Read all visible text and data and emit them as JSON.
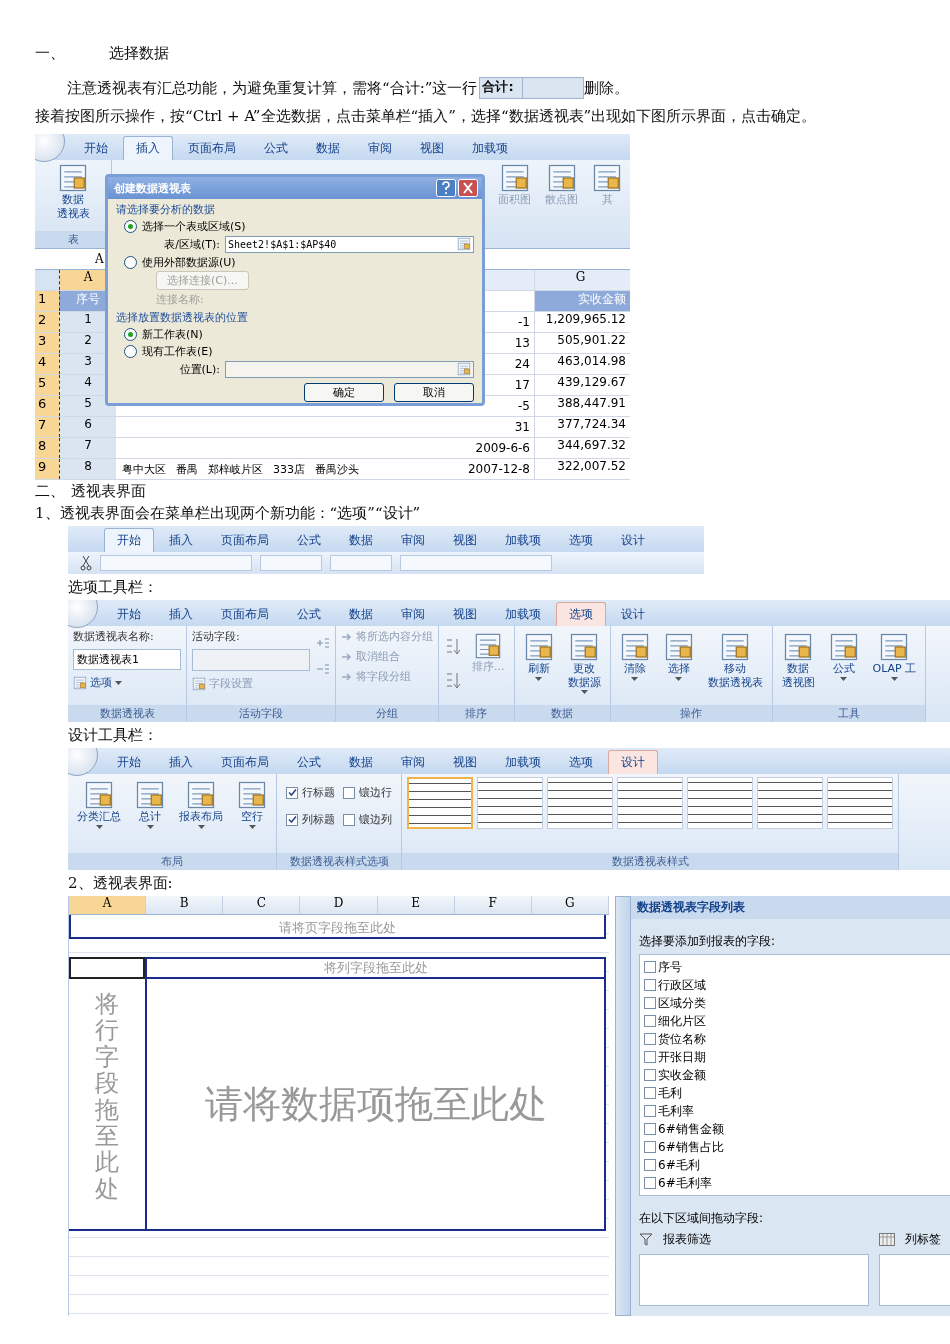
{
  "heading": {
    "number": "一、",
    "text": "选择数据"
  },
  "intro": [
    {
      "before": "注意透视表有汇总功能，为避免重复计算，需将“合计:”这一行",
      "cell": "合计:",
      "after": "删除。"
    },
    {
      "before": "接着按图所示操作，按“Ctrl + A”全选数据，点击菜单栏“插入”，选择“数据透视表”出现如下图所示界面，点击确定。"
    }
  ],
  "excel_insert": {
    "tabs": [
      {
        "label": "开始",
        "selected": false
      },
      {
        "label": "插入",
        "selected": true
      },
      {
        "label": "页面布局",
        "selected": false
      },
      {
        "label": "公式",
        "selected": false
      },
      {
        "label": "数据",
        "selected": false
      },
      {
        "label": "审阅",
        "selected": false
      },
      {
        "label": "视图",
        "selected": false
      },
      {
        "label": "加载项",
        "selected": false
      }
    ],
    "ribbon": {
      "pivot_button": [
        "数据",
        "透视表"
      ],
      "group_label": "表",
      "chart_buttons": [
        "面积图",
        "散点图",
        "其"
      ]
    },
    "name_box": "A",
    "columns": [
      {
        "label": "A",
        "selected": true
      },
      {
        "label": "G",
        "selected": false
      }
    ],
    "rows": [
      {
        "number": "1",
        "a": "序号",
        "g": "实收金额"
      },
      {
        "number": "2",
        "a": "1",
        "f": "-1",
        "g": "1,209,965.12"
      },
      {
        "number": "3",
        "a": "2",
        "f": "13",
        "g": "505,901.22"
      },
      {
        "number": "4",
        "a": "3",
        "f": "24",
        "g": "463,014.98"
      },
      {
        "number": "5",
        "a": "4",
        "f": "17",
        "g": "439,129.67"
      },
      {
        "number": "6",
        "a": "5",
        "f": "-5",
        "g": "388,447.91"
      },
      {
        "number": "7",
        "a": "6",
        "f": "31",
        "g": "377,724.34"
      },
      {
        "number": "8",
        "a": "7",
        "f": "2009-6-6",
        "g": "344,697.32"
      },
      {
        "number": "9",
        "a": "8",
        "middle": [
          "粤中大区",
          "番禺",
          "郑梓岐片区",
          "333店",
          "番禺沙头"
        ],
        "f": "2007-12-8",
        "g": "322,007.52"
      }
    ],
    "dialog": {
      "title": "创建数据透视表",
      "section_1": "请选择要分析的数据",
      "source_options": [
        {
          "label": "选择一个表或区域(S)",
          "selected": true
        },
        {
          "label": "使用外部数据源(U)",
          "selected": false
        }
      ],
      "range_label": "表/区域(T):",
      "range_value": "Sheet2!$A$1:$AP$40",
      "connection_button": "选择连接(C)...",
      "connection_label": "连接名称:",
      "section_2": "选择放置数据透视表的位置",
      "target_options": [
        {
          "label": "新工作表(N)",
          "selected": true
        },
        {
          "label": "现有工作表(E)",
          "selected": false
        }
      ],
      "location_label": "位置(L):",
      "ok": "确定",
      "cancel": "取消"
    }
  },
  "section_two": {
    "number": "二、",
    "text": "透视表界面",
    "note": "1、透视表界面会在菜单栏出现两个新功能：“选项”“设计”"
  },
  "ribbon_strip": {
    "tabs": [
      {
        "label": "开始",
        "selected": true
      },
      {
        "label": "插入",
        "selected": false
      },
      {
        "label": "页面布局",
        "selected": false
      },
      {
        "label": "公式",
        "selected": false
      },
      {
        "label": "数据",
        "selected": false
      },
      {
        "label": "审阅",
        "selected": false
      },
      {
        "label": "视图",
        "selected": false
      },
      {
        "label": "加载项",
        "selected": false
      },
      {
        "label": "选项",
        "selected": false
      },
      {
        "label": "设计",
        "selected": false
      }
    ]
  },
  "options_caption": "选项工具栏：",
  "options_ribbon": {
    "tabs": [
      {
        "label": "开始",
        "selected": false
      },
      {
        "label": "插入",
        "selected": false
      },
      {
        "label": "页面布局",
        "selected": false
      },
      {
        "label": "公式",
        "selected": false
      },
      {
        "label": "数据",
        "selected": false
      },
      {
        "label": "审阅",
        "selected": false
      },
      {
        "label": "视图",
        "selected": false
      },
      {
        "label": "加载项",
        "selected": false
      },
      {
        "label": "选项",
        "selected": true
      },
      {
        "label": "设计",
        "selected": false
      }
    ],
    "groups": [
      {
        "kind": "pivot_name",
        "label": "数据透视表",
        "caption": "数据透视表名称:",
        "value": "数据透视表1",
        "button": "选项"
      },
      {
        "kind": "active_field",
        "label": "活动字段",
        "caption": "活动字段:",
        "button": "字段设置"
      },
      {
        "kind": "list",
        "label": "分组",
        "items": [
          "将所选内容分组",
          "取消组合",
          "将字段分组"
        ]
      },
      {
        "kind": "sort",
        "label": "排序",
        "button": "排序..."
      },
      {
        "kind": "buttons",
        "label": "数据",
        "items": [
          {
            "lines": [
              "刷新"
            ],
            "dropdown": true
          },
          {
            "lines": [
              "更改",
              "数据源"
            ],
            "dropdown": true
          }
        ]
      },
      {
        "kind": "buttons",
        "label": "操作",
        "items": [
          {
            "lines": [
              "清除"
            ],
            "dropdown": true
          },
          {
            "lines": [
              "选择"
            ],
            "dropdown": true
          },
          {
            "lines": [
              "移动",
              "数据透视表"
            ],
            "dropdown": false
          }
        ]
      },
      {
        "kind": "buttons",
        "label": "工具",
        "items": [
          {
            "lines": [
              "数据",
              "透视图"
            ],
            "dropdown": false
          },
          {
            "lines": [
              "公式"
            ],
            "dropdown": true
          },
          {
            "lines": [
              "OLAP 工"
            ],
            "dropdown": true
          }
        ]
      }
    ]
  },
  "design_caption": "设计工具栏：",
  "design_ribbon": {
    "tabs": [
      {
        "label": "开始",
        "selected": false
      },
      {
        "label": "插入",
        "selected": false
      },
      {
        "label": "页面布局",
        "selected": false
      },
      {
        "label": "公式",
        "selected": false
      },
      {
        "label": "数据",
        "selected": false
      },
      {
        "label": "审阅",
        "selected": false
      },
      {
        "label": "视图",
        "selected": false
      },
      {
        "label": "加载项",
        "selected": false
      },
      {
        "label": "选项",
        "selected": false
      },
      {
        "label": "设计",
        "selected": true
      }
    ],
    "groups": [
      {
        "kind": "buttons",
        "label": "布局",
        "items": [
          {
            "lines": [
              "分类汇总"
            ],
            "dropdown": true
          },
          {
            "lines": [
              "总计"
            ],
            "dropdown": true
          },
          {
            "lines": [
              "报表布局"
            ],
            "dropdown": true
          },
          {
            "lines": [
              "空行"
            ],
            "dropdown": true
          }
        ]
      },
      {
        "kind": "checks",
        "label": "数据透视表样式选项",
        "items": [
          {
            "label": "行标题",
            "checked": true
          },
          {
            "label": "镶边行",
            "checked": false
          },
          {
            "label": "列标题",
            "checked": true
          },
          {
            "label": "镶边列",
            "checked": false
          }
        ]
      },
      {
        "kind": "styles",
        "label": "数据透视表样式",
        "items": [
          {
            "selected": true
          },
          {
            "selected": false
          },
          {
            "selected": false
          },
          {
            "selected": false
          },
          {
            "selected": false
          },
          {
            "selected": false
          },
          {
            "selected": false
          }
        ]
      }
    ]
  },
  "pivot_caption": "2、透视表界面:",
  "pivot_view": {
    "columns": [
      {
        "label": "A",
        "selected": true
      },
      {
        "label": "B",
        "selected": false
      },
      {
        "label": "C",
        "selected": false
      },
      {
        "label": "D",
        "selected": false
      },
      {
        "label": "E",
        "selected": false
      },
      {
        "label": "F",
        "selected": false
      },
      {
        "label": "G",
        "selected": false
      }
    ],
    "page_drop": "请将页字段拖至此处",
    "column_drop": "将列字段拖至此处",
    "row_drop": "将行字段拖至此处",
    "data_drop": "请将数据项拖至此处",
    "field_list": {
      "title": "数据透视表字段列表",
      "prompt": "选择要添加到报表的字段:",
      "fields": [
        {
          "label": "序号",
          "checked": false
        },
        {
          "label": "行政区域",
          "checked": false
        },
        {
          "label": "区域分类",
          "checked": false
        },
        {
          "label": "细化片区",
          "checked": false
        },
        {
          "label": "货位名称",
          "checked": false
        },
        {
          "label": "开张日期",
          "checked": false
        },
        {
          "label": "实收金额",
          "checked": false
        },
        {
          "label": "毛利",
          "checked": false
        },
        {
          "label": "毛利率",
          "checked": false
        },
        {
          "label": "6#销售金额",
          "checked": false
        },
        {
          "label": "6#销售占比",
          "checked": false
        },
        {
          "label": "6#毛利",
          "checked": false
        },
        {
          "label": "6#毛利率",
          "checked": false
        }
      ],
      "areas_prompt": "在以下区域间拖动字段:",
      "areas": [
        {
          "kind": "filter",
          "label": "报表筛选"
        },
        {
          "kind": "columns",
          "label": "列标签"
        }
      ]
    }
  }
}
